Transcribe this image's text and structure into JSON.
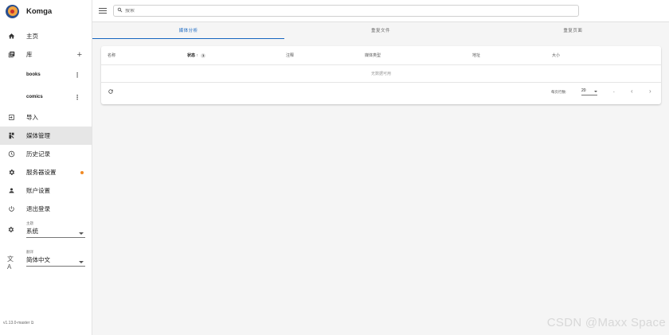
{
  "app": {
    "name": "Komga"
  },
  "nav": {
    "home": "主页",
    "libraries": "库",
    "library_items": [
      "books",
      "comics"
    ],
    "import": "导入",
    "media_management": "媒体管理",
    "history": "历史记录",
    "server_settings": "服务器设置",
    "account_settings": "账户设置",
    "logout": "退出登录"
  },
  "theme": {
    "caption": "主题",
    "value": "系统"
  },
  "language": {
    "caption": "翻译",
    "value": "简体中文"
  },
  "version": "v1.13.0-master",
  "search": {
    "placeholder": "搜索"
  },
  "tabs": [
    "媒体分析",
    "重复文件",
    "重复页面"
  ],
  "table": {
    "columns": [
      "名称",
      "状态",
      "注释",
      "媒体类型",
      "地址",
      "大小"
    ],
    "sort_indicator": "↑",
    "sort_badge": "1",
    "empty_text": "无数据可用"
  },
  "pagination": {
    "rows_per_page_label": "每页行数:",
    "rows_per_page": "20",
    "range": "-",
    "prev": "‹",
    "next": "›"
  },
  "watermark": "CSDN @Maxx Space",
  "colors": {
    "accent": "#1565c0",
    "notification_dot": "#f08a24"
  }
}
